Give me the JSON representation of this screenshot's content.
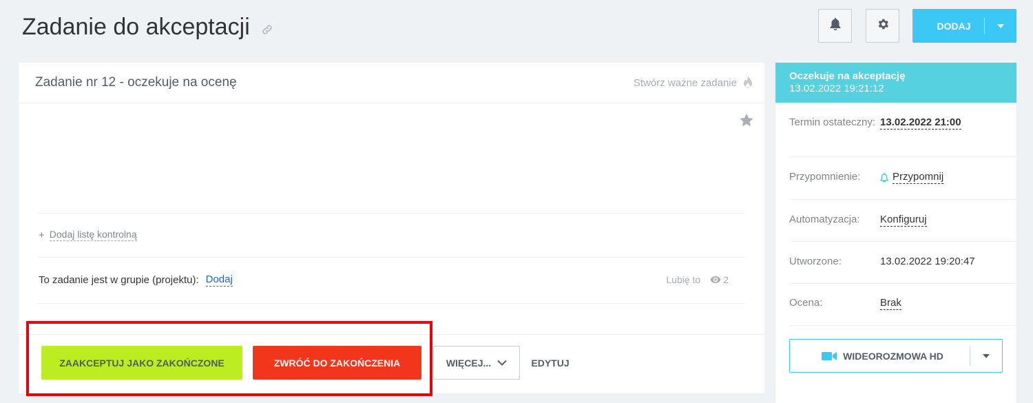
{
  "header": {
    "title": "Zadanie do akceptacji",
    "add_label": "DODAJ"
  },
  "task": {
    "title": "Zadanie nr 12 - oczekuje na ocenę",
    "important_label": "Stwórz ważne zadanie",
    "checklist_plus": "+",
    "checklist_label": "Dodaj listę kontrolną",
    "group_label": "To zadanie jest w grupie (projektu):",
    "group_add": "Dodaj",
    "like_label": "Lubię to",
    "views": "2"
  },
  "actions": {
    "accept": "ZAAKCEPTUJ JAKO ZAKOŃCZONE",
    "return": "ZWRÓĆ DO ZAKOŃCZENIA",
    "more": "WIĘCEJ...",
    "edit": "EDYTUJ"
  },
  "sidebar": {
    "status_title": "Oczekuje na akceptację",
    "status_time": "13.02.2022 19:21:12",
    "deadline_label": "Termin ostateczny:",
    "deadline_value": "13.02.2022 21:00",
    "reminder_label": "Przypomnienie:",
    "reminder_value": "Przypomnij",
    "automation_label": "Automatyzacja:",
    "automation_value": "Konfiguruj",
    "created_label": "Utworzone:",
    "created_value": "13.02.2022 19:20:47",
    "rating_label": "Ocena:",
    "rating_value": "Brak",
    "video_label": "WIDEOROZMOWA HD"
  },
  "colors": {
    "accent": "#3bc8f5",
    "accept": "#bbed21",
    "return": "#f1361b",
    "status": "#56d1e0",
    "highlight": "#e8000b"
  }
}
